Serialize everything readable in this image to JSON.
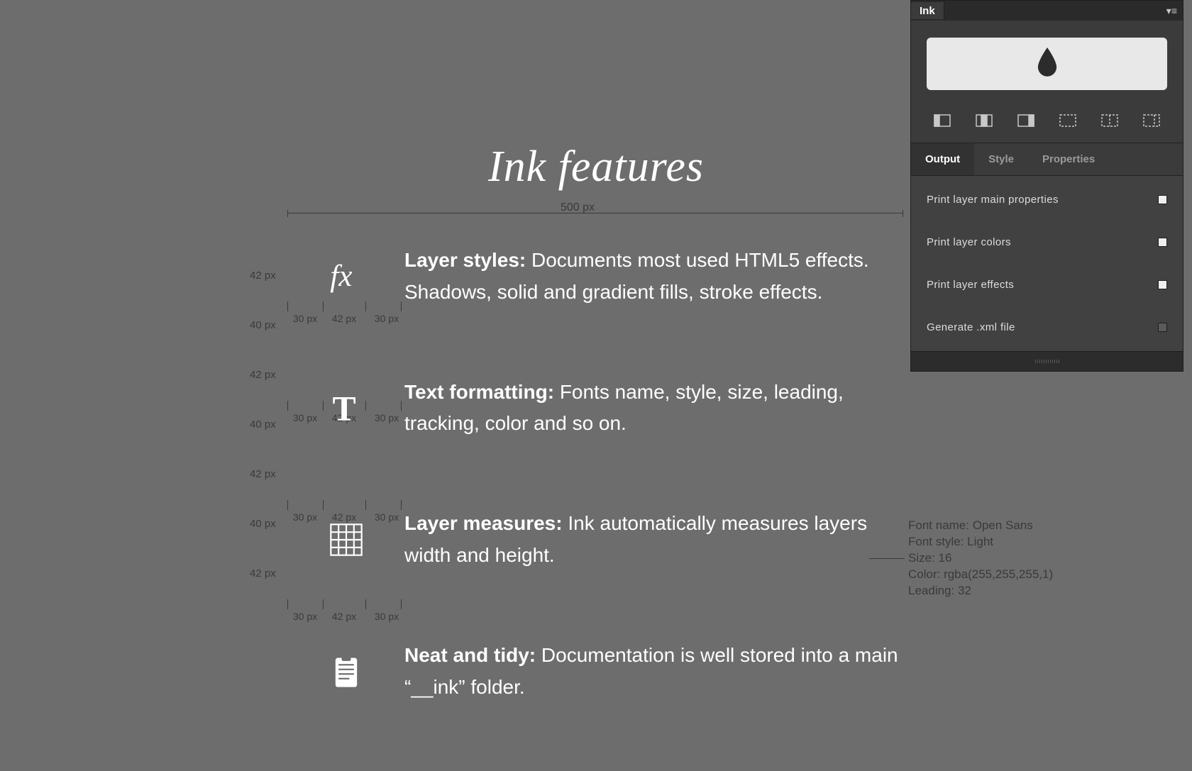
{
  "page": {
    "title": "Ink features",
    "top_measure": "500 px"
  },
  "features": [
    {
      "icon": "fx-icon",
      "title": "Layer styles:",
      "body": "Documents most used HTML5 effects. Shadows, solid and gradient fills, stroke effects."
    },
    {
      "icon": "text-icon",
      "title": "Text formatting:",
      "body": "Fonts name, style, size, leading, tracking, color and so on."
    },
    {
      "icon": "grid-icon",
      "title": "Layer measures:",
      "body": "Ink automatically measures layers width and height."
    },
    {
      "icon": "clipboard-icon",
      "title": "Neat and tidy:",
      "body": "Documentation is well stored into a main “__ink” folder."
    }
  ],
  "measure_segments": [
    "30 px",
    "42 px",
    "30 px"
  ],
  "row_heights": [
    "42 px",
    "42 px",
    "42 px",
    "42 px"
  ],
  "row_gaps": [
    "40 px",
    "40 px",
    "40 px"
  ],
  "font_meta": [
    "Font name: Open Sans",
    "Font style: Light",
    "Size: 16",
    "Color: rgba(255,255,255,1)",
    "Leading: 32"
  ],
  "panel": {
    "title": "Ink",
    "layout_icons": [
      "layout-left",
      "layout-center",
      "layout-right",
      "layout-split-h",
      "layout-split-v",
      "layout-right-split"
    ],
    "tabs": [
      "Output",
      "Style",
      "Properties"
    ],
    "active_tab": 0,
    "options": [
      {
        "label": "Print layer main properties",
        "checked": true
      },
      {
        "label": "Print layer colors",
        "checked": true
      },
      {
        "label": "Print layer effects",
        "checked": true
      },
      {
        "label": "Generate .xml file",
        "checked": false
      }
    ]
  }
}
